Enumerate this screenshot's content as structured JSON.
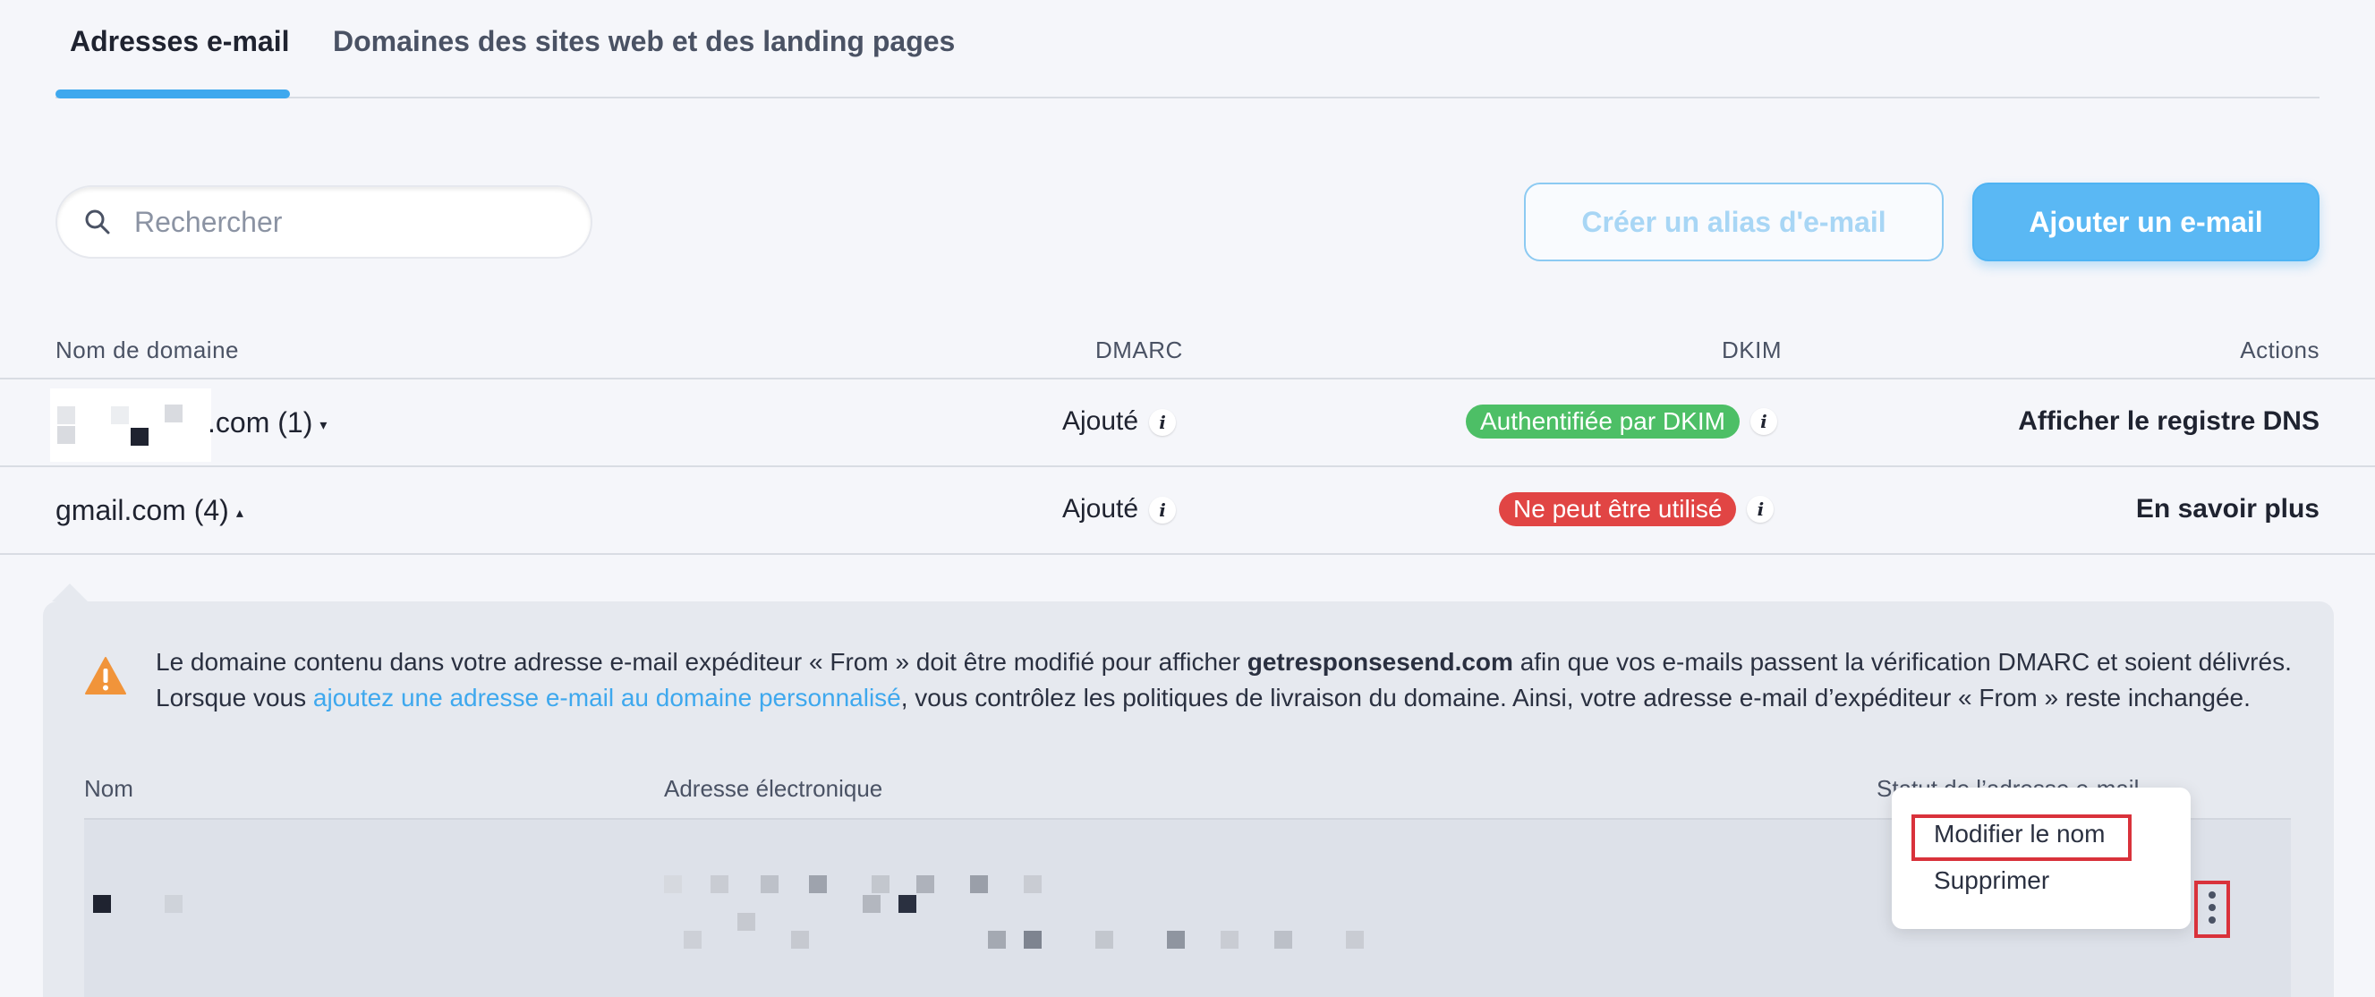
{
  "tabs": [
    {
      "label": "Adresses e-mail",
      "active": true
    },
    {
      "label": "Domaines des sites web et des landing pages",
      "active": false
    }
  ],
  "search": {
    "placeholder": "Rechercher",
    "value": ""
  },
  "buttons": {
    "alias_label": "Créer un alias d'e-mail",
    "add_label": "Ajouter un e-mail"
  },
  "table": {
    "headers": {
      "domain": "Nom de domaine",
      "dmarc": "DMARC",
      "dkim": "DKIM",
      "actions": "Actions"
    },
    "rows": [
      {
        "domain_suffix": ".com (1)",
        "caret": "▾",
        "dmarc": "Ajouté",
        "dkim": "Authentifiée par DKIM",
        "dkim_status": "success",
        "action": "Afficher le registre DNS"
      },
      {
        "domain": "gmail.com (4)",
        "caret": "▴",
        "dmarc": "Ajouté",
        "dkim": "Ne peut être utilisé",
        "dkim_status": "error",
        "action": "En savoir plus"
      }
    ]
  },
  "notice": {
    "part1": "Le domaine contenu dans votre adresse e-mail expéditeur « From » doit être modifié pour afficher ",
    "bold": "getresponsesend.com",
    "part2": " afin que vos e-mails passent la vérification DMARC et soient délivrés.",
    "part3": "Lorsque vous ",
    "link": "ajoutez une adresse e-mail au domaine personnalisé",
    "part4": ", vous contrôlez les politiques de livraison du domaine. Ainsi, votre adresse e-mail d’expéditeur « From » reste inchangée."
  },
  "sub_table": {
    "headers": {
      "name": "Nom",
      "email": "Adresse électronique",
      "status": "Statut de l’adresse e-mail"
    }
  },
  "menu": {
    "edit_label": "Modifier le nom",
    "delete_label": "Supprimer"
  },
  "colors": {
    "accent": "#3ea8ee",
    "success": "#4dbf66",
    "error": "#e14544",
    "highlight": "#d9323b"
  }
}
